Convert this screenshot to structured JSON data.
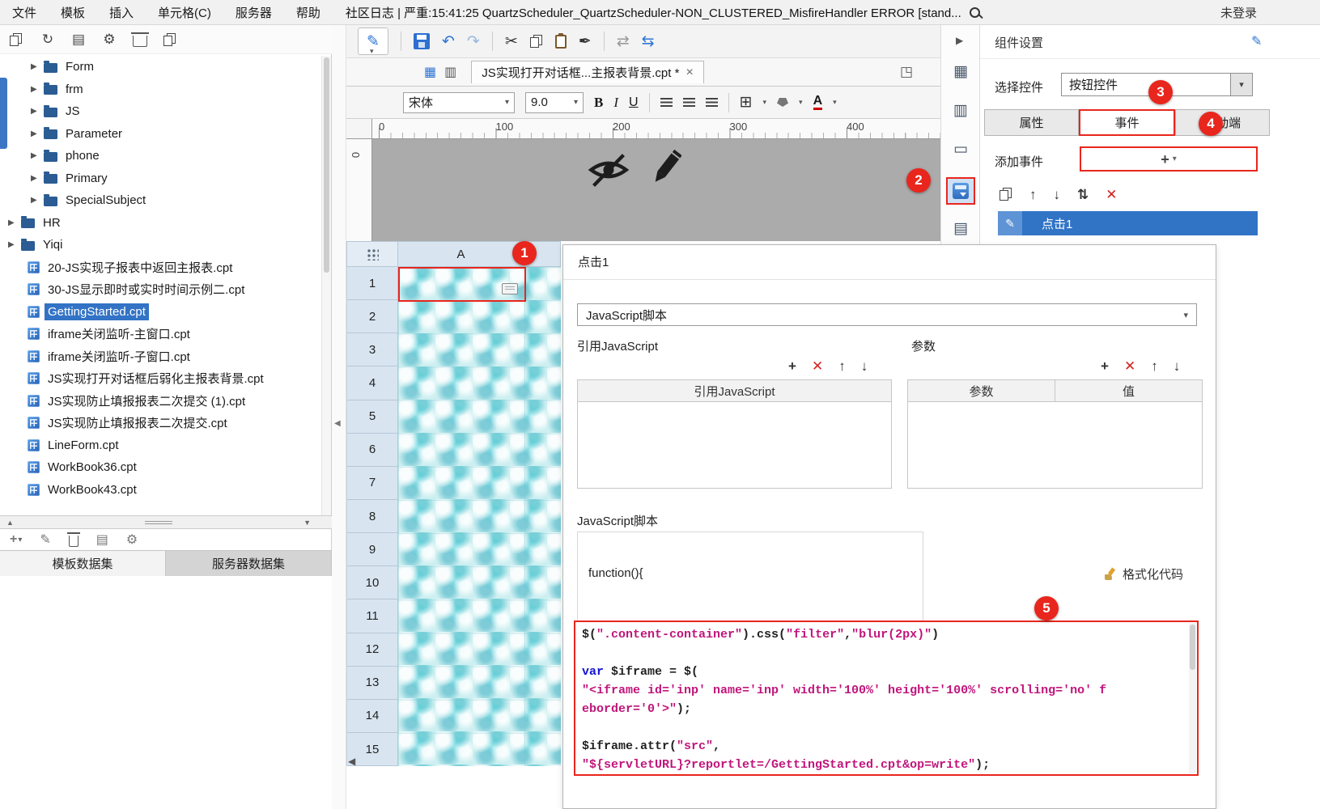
{
  "colors": {
    "accent_blue": "#3273c5",
    "badge_red": "#e8261d"
  },
  "icons": {
    "tree_arrow": "▶",
    "chevron_down": "▾",
    "close": "×",
    "plus": "+",
    "delete_x": "✕",
    "arrow_up": "↑",
    "arrow_down": "↓",
    "sort": "⇅",
    "undo": "↶",
    "redo": "↷",
    "cut": "✂",
    "pencil": "✎",
    "gear": "⚙",
    "refresh": "↻",
    "grid": "▦",
    "grid2": "▥",
    "doc": "▤",
    "rect": "▭",
    "swap": "⇄",
    "swap2": "⇆",
    "left_small": "◀",
    "right_small": "▶",
    "tri_down": "▼",
    "tri_up": "▲",
    "brush_pen": "✒",
    "corner_window": "◳",
    "border_grid": "⊞"
  },
  "menubar": {
    "items": [
      "文件",
      "模板",
      "插入",
      "单元格(C)",
      "服务器",
      "帮助"
    ],
    "status_text": "社区日志 | 严重:15:41:25 QuartzScheduler_QuartzScheduler-NON_CLUSTERED_MisfireHandler ERROR [stand...",
    "login_status": "未登录"
  },
  "sidebar": {
    "tree": [
      {
        "label": "Form",
        "type": "folder",
        "level": 2,
        "arrow": true
      },
      {
        "label": "frm",
        "type": "folder",
        "level": 2,
        "arrow": true
      },
      {
        "label": "JS",
        "type": "folder",
        "level": 2,
        "arrow": true
      },
      {
        "label": "Parameter",
        "type": "folder",
        "level": 2,
        "arrow": true
      },
      {
        "label": "phone",
        "type": "folder",
        "level": 2,
        "arrow": true
      },
      {
        "label": "Primary",
        "type": "folder",
        "level": 2,
        "arrow": true
      },
      {
        "label": "SpecialSubject",
        "type": "folder",
        "level": 2,
        "arrow": true
      },
      {
        "label": "HR",
        "type": "folder",
        "level": 1,
        "arrow": true
      },
      {
        "label": "Yiqi",
        "type": "folder",
        "level": 1,
        "arrow": true
      },
      {
        "label": "20-JS实现子报表中返回主报表.cpt",
        "type": "file",
        "level": 2,
        "arrow": false
      },
      {
        "label": "30-JS显示即时或实时时间示例二.cpt",
        "type": "file",
        "level": 2,
        "arrow": false
      },
      {
        "label": "GettingStarted.cpt",
        "type": "file",
        "level": 2,
        "arrow": false,
        "selected": true
      },
      {
        "label": "iframe关闭监听-主窗口.cpt",
        "type": "file",
        "level": 2,
        "arrow": false
      },
      {
        "label": "iframe关闭监听-子窗口.cpt",
        "type": "file",
        "level": 2,
        "arrow": false
      },
      {
        "label": "JS实现打开对话框后弱化主报表背景.cpt",
        "type": "file",
        "level": 2,
        "arrow": false
      },
      {
        "label": "JS实现防止填报报表二次提交 (1).cpt",
        "type": "file",
        "level": 2,
        "arrow": false
      },
      {
        "label": "JS实现防止填报报表二次提交.cpt",
        "type": "file",
        "level": 2,
        "arrow": false
      },
      {
        "label": "LineForm.cpt",
        "type": "file",
        "level": 2,
        "arrow": false
      },
      {
        "label": "WorkBook36.cpt",
        "type": "file",
        "level": 2,
        "arrow": false
      },
      {
        "label": "WorkBook43.cpt",
        "type": "file",
        "level": 2,
        "arrow": false
      }
    ],
    "dataset_tabs": [
      "模板数据集",
      "服务器数据集"
    ],
    "active_dataset_tab": 0
  },
  "editor": {
    "tab": {
      "title": "JS实现打开对话框...主报表背景.cpt *"
    },
    "toolbar": {
      "font": "宋体",
      "size": "9.0",
      "bold_label": "B",
      "italic_label": "I",
      "underline_label": "U",
      "fontcolor_label": "A"
    },
    "ruler": [
      "0",
      "100",
      "200",
      "300",
      "400"
    ],
    "vruler_zero": "0",
    "grid": {
      "col": "A",
      "rows": [
        "1",
        "2",
        "3",
        "4",
        "5",
        "6",
        "7",
        "8",
        "9",
        "10",
        "11",
        "12",
        "13",
        "14",
        "15"
      ]
    }
  },
  "right_panel": {
    "title": "组件设置",
    "select_label": "选择控件",
    "select_value": "按钮控件",
    "tabs": [
      "属性",
      "事件",
      "移动端"
    ],
    "active_tab_index": 1,
    "add_event": "添加事件",
    "event_name": "点击1"
  },
  "event_panel": {
    "title": "点击1",
    "type_value": "JavaScript脚本",
    "ref_label": "引用JavaScript",
    "ref_table_header": "引用JavaScript",
    "param_label": "参数",
    "param_headers": [
      "参数",
      "值"
    ],
    "js_label": "JavaScript脚本",
    "function_line": "function(){",
    "format_button": "格式化代码",
    "code_lines": [
      [
        {
          "t": "p",
          "s": "$("
        },
        {
          "t": "s",
          "s": "\".content-container\""
        },
        {
          "t": "p",
          "s": ").css("
        },
        {
          "t": "s",
          "s": "\"filter\""
        },
        {
          "t": "p",
          "s": ","
        },
        {
          "t": "s",
          "s": "\"blur(2px)\""
        },
        {
          "t": "p",
          "s": ")"
        }
      ],
      [],
      [
        {
          "t": "k",
          "s": "var"
        },
        {
          "t": "p",
          "s": " $iframe = $("
        }
      ],
      [
        {
          "t": "s",
          "s": "\"<iframe id='inp' name='inp' width='100%' height='100%' scrolling='no' f"
        }
      ],
      [
        {
          "t": "s",
          "s": "eborder='0'>\""
        },
        {
          "t": "p",
          "s": ");"
        }
      ],
      [],
      [
        {
          "t": "p",
          "s": "$iframe.attr("
        },
        {
          "t": "s",
          "s": "\"src\""
        },
        {
          "t": "p",
          "s": ","
        }
      ],
      [
        {
          "t": "s",
          "s": "\"${servletURL}?reportlet=/GettingStarted.cpt&op=write\""
        },
        {
          "t": "p",
          "s": ");"
        }
      ]
    ]
  },
  "badges": {
    "b1": "1",
    "b2": "2",
    "b3": "3",
    "b4": "4",
    "b5": "5"
  }
}
